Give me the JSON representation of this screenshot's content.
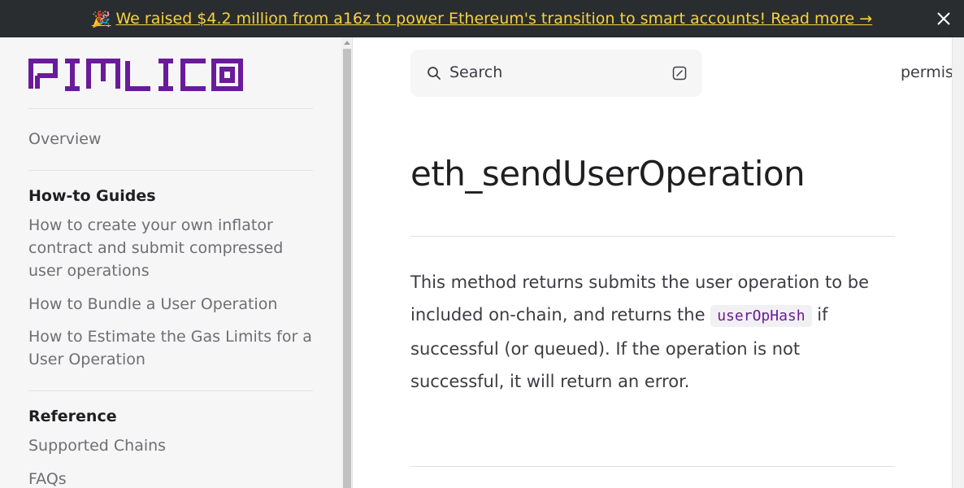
{
  "banner": {
    "emoji": "🎉",
    "text": "We raised $4.2 million from a16z to power Ethereum's transition to smart accounts! Read more →"
  },
  "sidebar": {
    "logo_text": "PIMLICO",
    "overview": "Overview",
    "sections": [
      {
        "heading": "How-to Guides",
        "items": [
          "How to create your own inflator contract and submit compressed user operations",
          "How to Bundle a User Operation",
          "How to Estimate the Gas Limits for a User Operation"
        ]
      },
      {
        "heading": "Reference",
        "items": [
          "Supported Chains",
          "FAQs"
        ]
      }
    ]
  },
  "main": {
    "search_label": "Search",
    "nav_cut": "permis",
    "title": "eth_sendUserOperation",
    "para_before": "This method returns submits the user operation to be included on-chain, and returns the",
    "code": "userOpHash",
    "para_after": "if successful (or queued). If the operation is not successful, it will return an error."
  },
  "colors": {
    "brand": "#6a1b9a",
    "banner_bg": "#2a2d2f",
    "banner_link": "#f7d23e"
  }
}
